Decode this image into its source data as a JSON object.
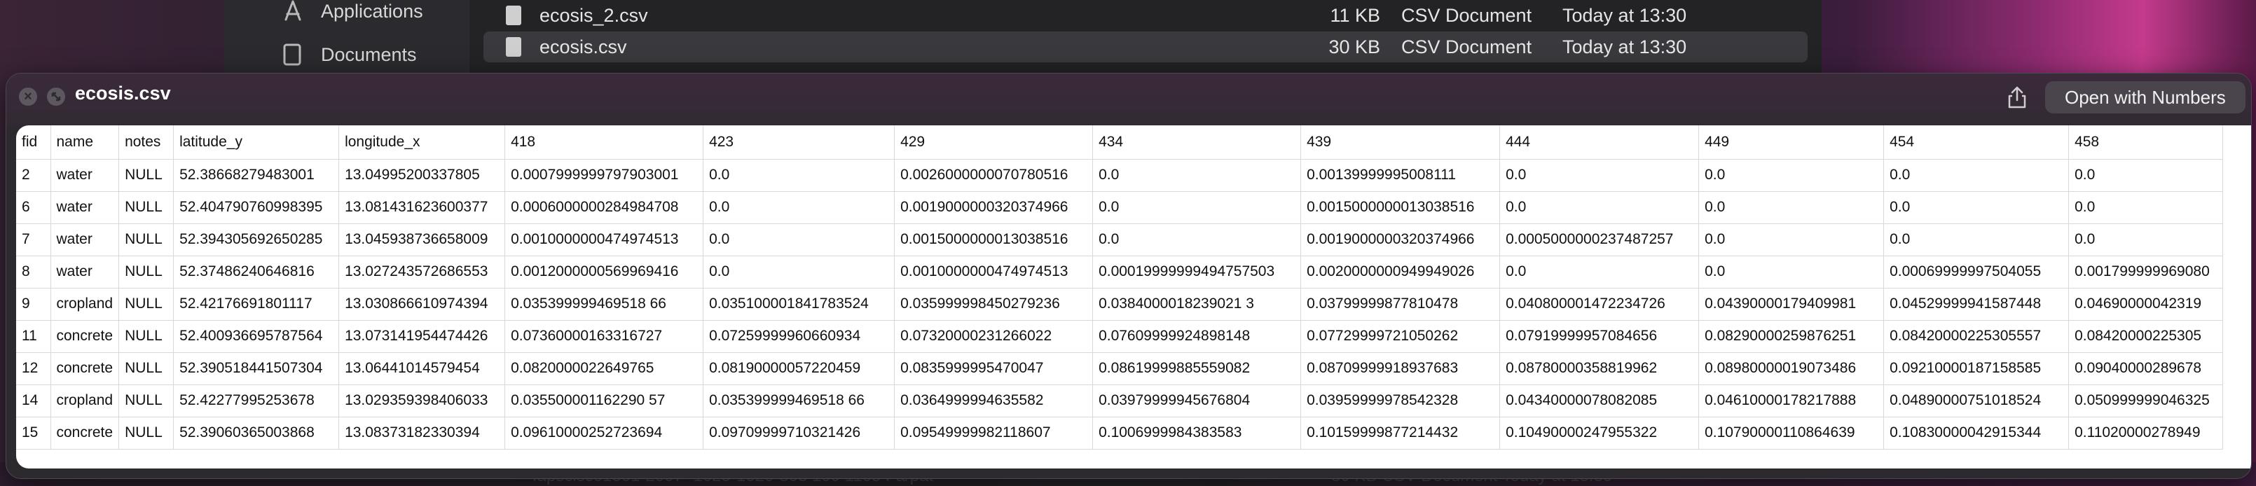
{
  "finder": {
    "sidebar": [
      {
        "label": "Applications",
        "icon": "applications-icon"
      },
      {
        "label": "Documents",
        "icon": "documents-icon"
      }
    ],
    "files": [
      {
        "name": "ecosis_2.csv",
        "size": "11 KB",
        "kind": "CSV Document",
        "date": "Today at 13:30",
        "selected": false
      },
      {
        "name": "ecosis.csv",
        "size": "30 KB",
        "kind": "CSV Document",
        "date": "Today at 13:30",
        "selected": true
      }
    ]
  },
  "quicklook": {
    "title": "ecosis.csv",
    "open_button": "Open with Numbers",
    "share_icon": "share-icon",
    "close_icon": "close-icon",
    "fullscreen_icon": "fullscreen-icon"
  },
  "table": {
    "headers": [
      "fid",
      "name",
      "notes",
      "latitude_y",
      "longitude_x",
      "418",
      "423",
      "429",
      "434",
      "439",
      "444",
      "449",
      "454",
      "458"
    ],
    "rows": [
      [
        "2",
        "water",
        "NULL",
        "52.38668279483001",
        "13.04995200337805",
        "0.0007999999797903001",
        "0.0",
        "0.0026000000070780516",
        "0.0",
        "0.00139999995008111",
        "0.0",
        "0.0",
        "0.0",
        "0.0"
      ],
      [
        "6",
        "water",
        "NULL",
        "52.404790760998395",
        "13.081431623600377",
        "0.0006000000284984708",
        "0.0",
        "0.0019000000320374966",
        "0.0",
        "0.0015000000013038516",
        "0.0",
        "0.0",
        "0.0",
        "0.0"
      ],
      [
        "7",
        "water",
        "NULL",
        "52.394305692650285",
        "13.045938736658009",
        "0.0010000000474974513",
        "0.0",
        "0.0015000000013038516",
        "0.0",
        "0.0019000000320374966",
        "0.0005000000237487257",
        "0.0",
        "0.0",
        "0.0"
      ],
      [
        "8",
        "water",
        "NULL",
        "52.37486240646816",
        "13.027243572686553",
        "0.0012000000569969416",
        "0.0",
        "0.0010000000474974513",
        "0.00019999999494757503",
        "0.0020000000949949026",
        "0.0",
        "0.0",
        "0.00069999997504055",
        "0.001799999969080"
      ],
      [
        "9",
        "cropland",
        "NULL",
        "52.42176691801117",
        "13.030866610974394",
        "0.035399999469518 66",
        "0.035100001841783524",
        "0.035999998450279236",
        "0.0384000018239021 3",
        "0.03799999877810478",
        "0.040800001472234726",
        "0.04390000179409981",
        "0.04529999941587448",
        "0.04690000042319"
      ],
      [
        "11",
        "concrete",
        "NULL",
        "52.400936695787564",
        "13.073141954474426",
        "0.07360000163316727",
        "0.07259999960660934",
        "0.07320000231266022",
        "0.07609999924898148",
        "0.07729999721050262",
        "0.07919999957084656",
        "0.08290000259876251",
        "0.08420000225305557",
        "0.08420000225305"
      ],
      [
        "12",
        "concrete",
        "NULL",
        "52.390518441507304",
        "13.06441014579454",
        "0.0820000022649765",
        "0.08190000057220459",
        "0.0835999995470047",
        "0.08619999885559082",
        "0.08709999918937683",
        "0.08780000358819962",
        "0.08980000019073486",
        "0.09210000187158585",
        "0.09040000289678"
      ],
      [
        "14",
        "cropland",
        "NULL",
        "52.42277995253678",
        "13.029359398406033",
        "0.035500001162290 57",
        "0.035399999469518 66",
        "0.0364999994635582",
        "0.03979999945676804",
        "0.03959999978542328",
        "0.04340000078082085",
        "0.04610000178217888",
        "0.04890000751018524",
        "0.050999999046325"
      ],
      [
        "15",
        "concrete",
        "NULL",
        "52.39060365003868",
        "13.08373182330394",
        "0.09610000252723694",
        "0.09709999710321426",
        "0.09549999982118607",
        "0.1006999984383583",
        "0.10159999877214432",
        "0.10490000247955322",
        "0.10790000110864639",
        "0.10830000042915344",
        "0.11020000278949"
      ]
    ]
  },
  "ghost": {
    "a": "fapsclsc01301-2007- 1025-1020-303 100 1103 Fa/pat",
    "b": "30 KB   CSV Document   Today at 13:30"
  }
}
